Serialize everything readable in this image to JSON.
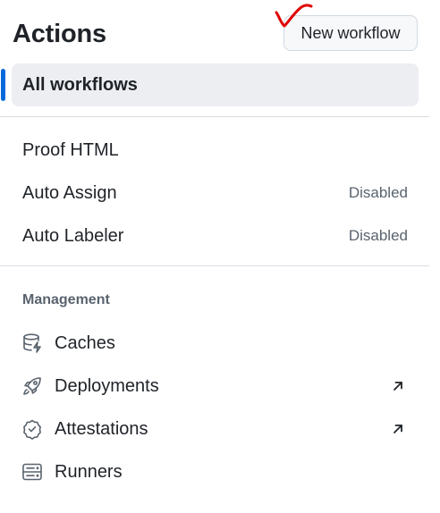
{
  "header": {
    "title": "Actions",
    "new_workflow_label": "New workflow"
  },
  "workflows": {
    "all_label": "All workflows",
    "items": [
      {
        "label": "Proof HTML",
        "status": ""
      },
      {
        "label": "Auto Assign",
        "status": "Disabled"
      },
      {
        "label": "Auto Labeler",
        "status": "Disabled"
      }
    ]
  },
  "management": {
    "heading": "Management",
    "items": [
      {
        "label": "Caches",
        "icon": "database-icon",
        "external": false
      },
      {
        "label": "Deployments",
        "icon": "rocket-icon",
        "external": true
      },
      {
        "label": "Attestations",
        "icon": "verified-shield-icon",
        "external": true
      },
      {
        "label": "Runners",
        "icon": "server-icon",
        "external": false
      }
    ]
  },
  "colors": {
    "accent": "#0969da",
    "active_bg": "#eceef1",
    "muted_text": "#59636e",
    "annotation": "#e00000"
  }
}
